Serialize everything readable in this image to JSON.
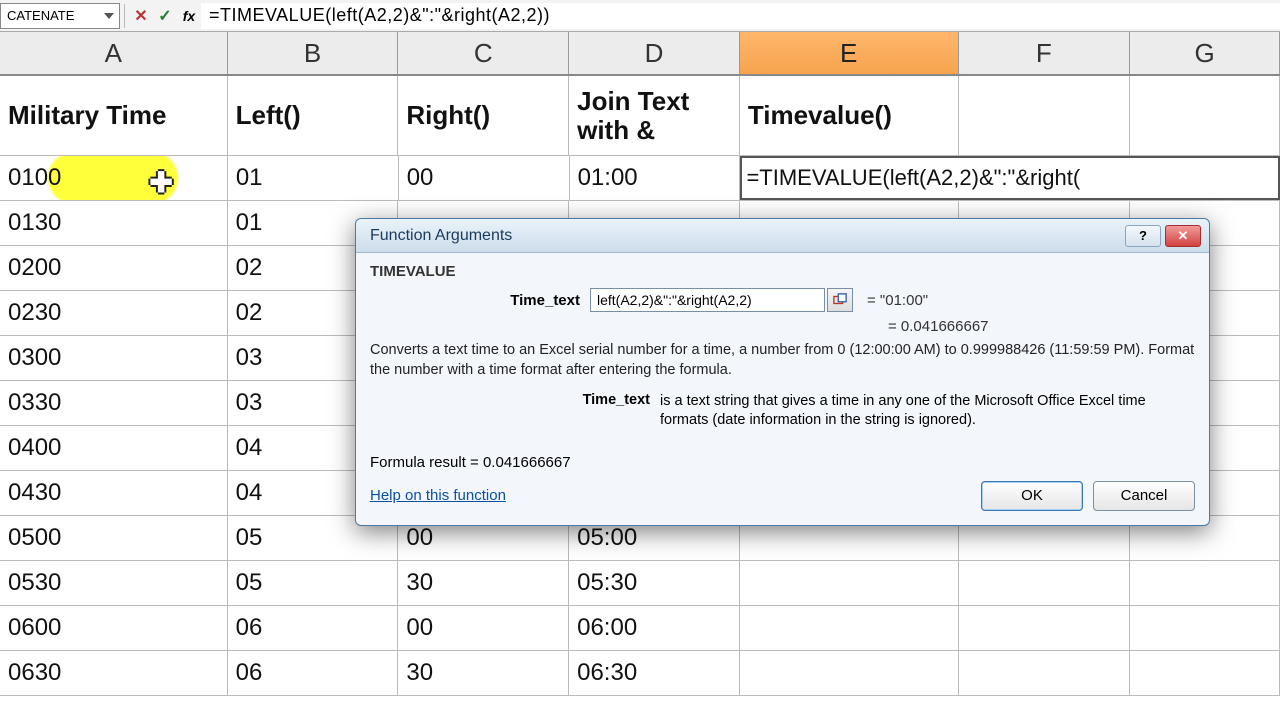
{
  "formula_bar": {
    "name_box": "CATENATE",
    "formula": "=TIMEVALUE(left(A2,2)&\":\"&right(A2,2))"
  },
  "columns": [
    "A",
    "B",
    "C",
    "D",
    "E",
    "F",
    "G"
  ],
  "selected_column_index": 4,
  "headers": {
    "A": "Military Time",
    "B": "Left()",
    "C": "Right()",
    "D": "Join Text with &",
    "E": "Timevalue()",
    "F": "",
    "G": ""
  },
  "editing_cell": {
    "address": "E2",
    "content": "=TIMEVALUE(left(A2,2)&\":\"&right("
  },
  "rows": [
    {
      "A": "0100",
      "B": "01",
      "C": "00",
      "D": "01:00",
      "E": ""
    },
    {
      "A": "0130",
      "B": "01",
      "C": "",
      "D": "",
      "E": ""
    },
    {
      "A": "0200",
      "B": "02",
      "C": "",
      "D": "",
      "E": ""
    },
    {
      "A": "0230",
      "B": "02",
      "C": "",
      "D": "",
      "E": ""
    },
    {
      "A": "0300",
      "B": "03",
      "C": "",
      "D": "",
      "E": ""
    },
    {
      "A": "0330",
      "B": "03",
      "C": "",
      "D": "",
      "E": ""
    },
    {
      "A": "0400",
      "B": "04",
      "C": "",
      "D": "",
      "E": ""
    },
    {
      "A": "0430",
      "B": "04",
      "C": "",
      "D": "",
      "E": ""
    },
    {
      "A": "0500",
      "B": "05",
      "C": "00",
      "D": "05:00",
      "E": ""
    },
    {
      "A": "0530",
      "B": "05",
      "C": "30",
      "D": "05:30",
      "E": ""
    },
    {
      "A": "0600",
      "B": "06",
      "C": "00",
      "D": "06:00",
      "E": ""
    },
    {
      "A": "0630",
      "B": "06",
      "C": "30",
      "D": "06:30",
      "E": ""
    }
  ],
  "dialog": {
    "title": "Function Arguments",
    "function": "TIMEVALUE",
    "arg_label": "Time_text",
    "arg_value": "left(A2,2)&\":\"&right(A2,2)",
    "eq1": "=   \"01:00\"",
    "eq2": "=   0.041666667",
    "description": "Converts a text time to an Excel serial number for a time, a number from 0 (12:00:00 AM) to 0.999988426 (11:59:59 PM). Format the number with a time format after entering the formula.",
    "arg_desc_label": "Time_text",
    "arg_desc": "is a text string that gives a time in any one of the Microsoft Office Excel time formats (date information in the string is ignored).",
    "result_label": "Formula result =   ",
    "result_value": "0.041666667",
    "help": "Help on this function",
    "ok": "OK",
    "cancel": "Cancel"
  }
}
